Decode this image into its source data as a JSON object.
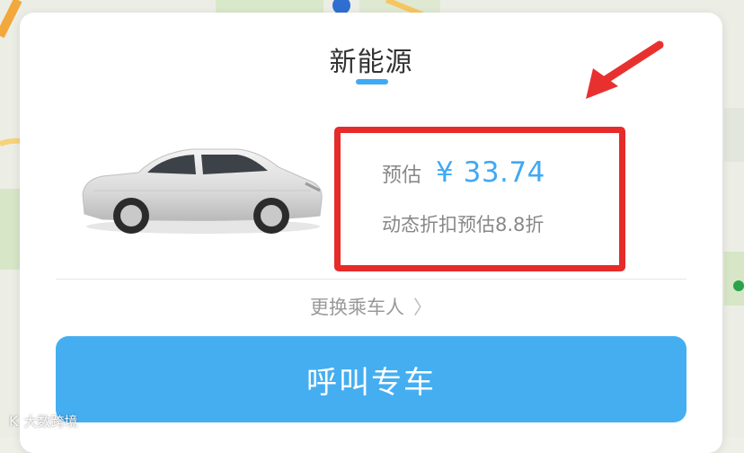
{
  "tab": {
    "title": "新能源"
  },
  "estimate": {
    "label": "预估",
    "price": "¥ 33.74",
    "discount_note": "动态折扣预估8.8折"
  },
  "change_rider": {
    "label": "更换乘车人",
    "chevron": "〉"
  },
  "call_button": {
    "label": "呼叫专车"
  },
  "watermark": {
    "logo": "K",
    "text": "大数跨境"
  },
  "icons": {
    "car": "car-image",
    "annotation": "red-arrow-icon",
    "chevron": "chevron-right-icon"
  },
  "colors": {
    "accent": "#3fa9f5",
    "button": "#45aef1",
    "highlight_border": "#e62b2b",
    "annotation_arrow": "#e8312f"
  }
}
